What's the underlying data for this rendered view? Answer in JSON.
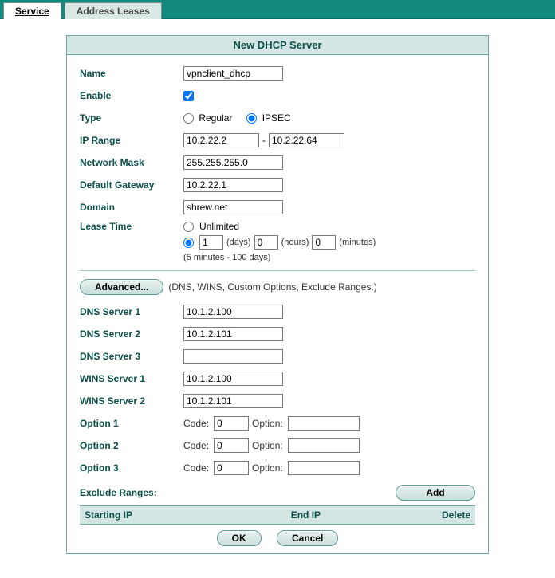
{
  "tabs": {
    "active": "Service",
    "inactive": "Address Leases"
  },
  "panel_title": "New DHCP Server",
  "labels": {
    "name": "Name",
    "enable": "Enable",
    "type": "Type",
    "ip_range": "IP Range",
    "network_mask": "Network Mask",
    "default_gateway": "Default Gateway",
    "domain": "Domain",
    "lease_time": "Lease Time"
  },
  "values": {
    "name": "vpnclient_dhcp",
    "enable": true,
    "type_regular": "Regular",
    "type_ipsec": "IPSEC",
    "type_selected": "IPSEC",
    "ip_range_start": "10.2.22.2",
    "ip_range_end": "10.2.22.64",
    "ip_range_sep": "-",
    "network_mask": "255.255.255.0",
    "default_gateway": "10.2.22.1",
    "domain": "shrew.net",
    "lease_unlimited_label": "Unlimited",
    "lease_days": "1",
    "lease_days_label": "(days)",
    "lease_hours": "0",
    "lease_hours_label": "(hours)",
    "lease_minutes": "0",
    "lease_minutes_label": "(minutes)",
    "lease_note": "(5 minutes - 100 days)"
  },
  "advanced": {
    "button": "Advanced...",
    "note": "(DNS, WINS, Custom Options, Exclude Ranges.)",
    "dns1_label": "DNS Server 1",
    "dns1": "10.1.2.100",
    "dns2_label": "DNS Server 2",
    "dns2": "10.1.2.101",
    "dns3_label": "DNS Server 3",
    "dns3": "",
    "wins1_label": "WINS Server 1",
    "wins1": "10.1.2.100",
    "wins2_label": "WINS Server 2",
    "wins2": "10.1.2.101",
    "option_code_label": "Code:",
    "option_value_label": "Option:",
    "opt1_label": "Option 1",
    "opt1_code": "0",
    "opt1_val": "",
    "opt2_label": "Option 2",
    "opt2_code": "0",
    "opt2_val": "",
    "opt3_label": "Option 3",
    "opt3_code": "0",
    "opt3_val": ""
  },
  "exclude": {
    "label": "Exclude Ranges:",
    "add_button": "Add",
    "col_start": "Starting IP",
    "col_end": "End IP",
    "col_delete": "Delete"
  },
  "footer": {
    "ok": "OK",
    "cancel": "Cancel"
  }
}
